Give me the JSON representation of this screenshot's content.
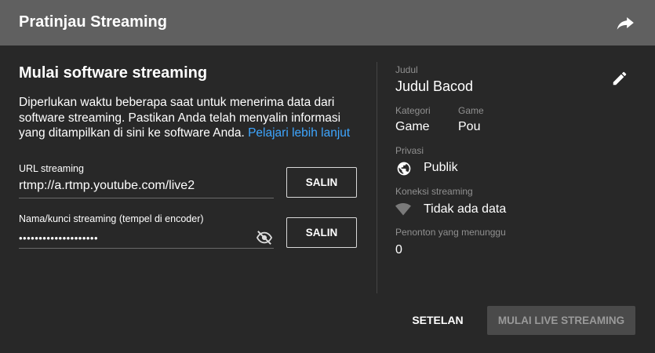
{
  "header": {
    "title": "Pratinjau Streaming",
    "share_icon": "share-arrow-icon"
  },
  "software": {
    "title": "Mulai software streaming",
    "description": "Diperlukan waktu beberapa saat untuk menerima data dari software streaming. Pastikan Anda telah menyalin informasi yang ditampilkan di sini ke software Anda.",
    "learn_more_link": "Pelajari lebih lanjut",
    "url_label": "URL streaming",
    "url_value": "rtmp://a.rtmp.youtube.com/live2",
    "key_label": "Nama/kunci streaming (tempel di encoder)",
    "key_value": "••••••••••••••••••••",
    "copy_label": "SALIN",
    "visibility_icon": "eye-off-icon"
  },
  "details": {
    "title_label": "Judul",
    "title_value": "Judul Bacod",
    "category_label": "Kategori",
    "category_value": "Game",
    "game_label": "Game",
    "game_value": "Pou",
    "privacy_label": "Privasi",
    "privacy_value": "Publik",
    "connection_label": "Koneksi streaming",
    "connection_value": "Tidak ada data",
    "viewers_label": "Penonton yang menunggu",
    "viewers_value": "0"
  },
  "footer": {
    "settings_label": "SETELAN",
    "go_live_label": "MULAI LIVE STREAMING"
  },
  "colors": {
    "header_bg": "#606060",
    "dialog_bg": "#282828",
    "link": "#3ea6ff",
    "disabled_button_bg": "#4a4a4a"
  }
}
